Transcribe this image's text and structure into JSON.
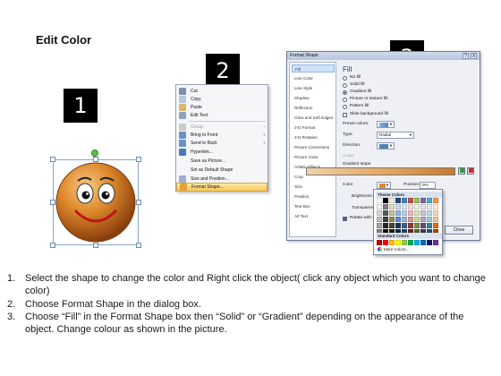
{
  "page": {
    "title": "Edit Color"
  },
  "steps": [
    "1",
    "2",
    "3"
  ],
  "context_menu": {
    "items": [
      {
        "label": "Cut",
        "enabled": true,
        "submenu": false
      },
      {
        "label": "Copy",
        "enabled": true,
        "submenu": false
      },
      {
        "label": "Paste",
        "enabled": true,
        "submenu": false
      },
      {
        "label": "Edit Text",
        "enabled": true,
        "submenu": false
      },
      {
        "label": "Group",
        "enabled": false,
        "submenu": true
      },
      {
        "label": "Bring to Front",
        "enabled": true,
        "submenu": true
      },
      {
        "label": "Send to Back",
        "enabled": true,
        "submenu": true
      },
      {
        "label": "Hyperlink...",
        "enabled": true,
        "submenu": false
      },
      {
        "label": "Save as Picture...",
        "enabled": true,
        "submenu": false
      },
      {
        "label": "Set as Default Shape",
        "enabled": true,
        "submenu": false
      },
      {
        "label": "Size and Position...",
        "enabled": true,
        "submenu": false
      },
      {
        "label": "Format Shape...",
        "enabled": true,
        "submenu": false,
        "highlighted": true
      }
    ]
  },
  "dialog": {
    "title": "Format Shape",
    "help": "?",
    "close_glyph": "X",
    "nav": [
      "Fill",
      "Line Color",
      "Line Style",
      "Shadow",
      "Reflection",
      "Glow and Soft Edges",
      "3-D Format",
      "3-D Rotation",
      "Picture Corrections",
      "Picture Color",
      "Artistic Effects",
      "Crop",
      "Size",
      "Position",
      "Text Box",
      "Alt Text"
    ],
    "active_nav": "Fill",
    "heading": "Fill",
    "fill_options": [
      {
        "label": "No fill",
        "selected": false
      },
      {
        "label": "Solid fill",
        "selected": false
      },
      {
        "label": "Gradient fill",
        "selected": true
      },
      {
        "label": "Picture or texture fill",
        "selected": false
      },
      {
        "label": "Pattern fill",
        "selected": false
      }
    ],
    "slide_background_label": "Slide background fill",
    "preset_colors_label": "Preset colors:",
    "type_label": "Type:",
    "type_value": "Radial",
    "direction_label": "Direction:",
    "angle_label": "Angle:",
    "gradient_stops_label": "Gradient stops",
    "color_label": "Color",
    "position_label": "Position:",
    "position_value": "0%",
    "brightness_label": "Brightness:",
    "transparency_label": "Transparency:",
    "rotate_label": "Rotate with shape",
    "close_label": "Close"
  },
  "palette": {
    "theme_header": "Theme Colors",
    "standard_header": "Standard Colors",
    "more_colors": "More Colors...",
    "theme_colors": [
      [
        "#ffffff",
        "#000000",
        "#eeece1",
        "#1f497d",
        "#4f81bd",
        "#c0504d",
        "#9bbb59",
        "#8064a2",
        "#4bacc6",
        "#f79646"
      ],
      [
        "#f2f2f2",
        "#7f7f7f",
        "#ddd9c3",
        "#c6d9f0",
        "#dbe5f1",
        "#f2dcdb",
        "#ebf1dd",
        "#e5e0ec",
        "#dbeef3",
        "#fdeada"
      ],
      [
        "#d8d8d8",
        "#595959",
        "#c4bd97",
        "#8db3e2",
        "#b8cce4",
        "#e5b9b7",
        "#d7e3bc",
        "#ccc1d9",
        "#b7dde8",
        "#fbd5b5"
      ],
      [
        "#bfbfbf",
        "#3f3f3f",
        "#938953",
        "#548dd4",
        "#95b3d7",
        "#d99694",
        "#c3d69b",
        "#b2a2c7",
        "#92cddc",
        "#fac08f"
      ],
      [
        "#a5a5a5",
        "#262626",
        "#494429",
        "#17365d",
        "#366092",
        "#953734",
        "#76923c",
        "#5f497a",
        "#31859b",
        "#e36c09"
      ],
      [
        "#7f7f7f",
        "#0c0c0c",
        "#1d1b10",
        "#0f243e",
        "#244061",
        "#632423",
        "#4f6128",
        "#3f3151",
        "#205867",
        "#974806"
      ]
    ],
    "standard_colors": [
      "#c00000",
      "#ff0000",
      "#ffc000",
      "#ffff00",
      "#92d050",
      "#00b050",
      "#00b0f0",
      "#0070c0",
      "#002060",
      "#7030a0"
    ]
  },
  "instructions": [
    {
      "num": "1.",
      "text": "Select the shape to change the color and Right click the object( click any object which you want to change color)"
    },
    {
      "num": "2.",
      "text": "Choose Format Shape in the dialog box."
    },
    {
      "num": "3.",
      "text": "Choose “Fill” in the Format Shape box then “Solid” or “Gradient” depending on the appearance of the object. Change colour as shown in the picture."
    }
  ],
  "colors": {
    "accent_orange": "#e08a2c",
    "highlight_menu": "#f7c85c",
    "dialog_border": "#6b7f9e"
  },
  "icons": [
    "cut-icon",
    "copy-icon",
    "paste-icon",
    "smiley-shape",
    "palette-icon"
  ]
}
